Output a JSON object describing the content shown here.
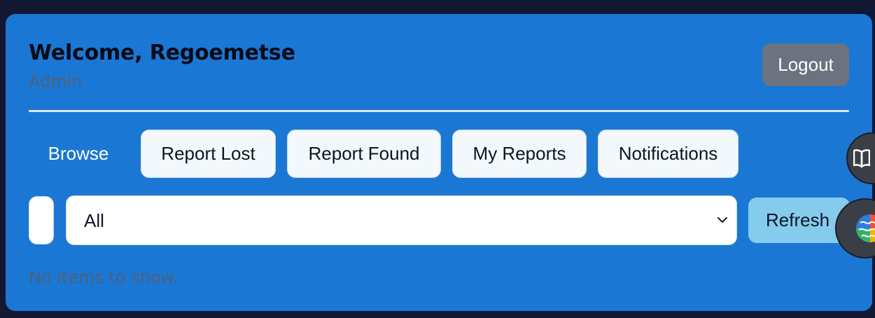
{
  "header": {
    "welcome": "Welcome, Regoemetse",
    "role": "Admin",
    "logout_label": "Logout"
  },
  "tabs": [
    {
      "label": "Browse",
      "active": true
    },
    {
      "label": "Report Lost",
      "active": false
    },
    {
      "label": "Report Found",
      "active": false
    },
    {
      "label": "My Reports",
      "active": false
    },
    {
      "label": "Notifications",
      "active": false
    }
  ],
  "filters": {
    "status_select_value": "All",
    "refresh_label": "Refresh"
  },
  "list": {
    "empty_message": "No items to show."
  },
  "floating_buttons": [
    {
      "icon": "book-icon"
    },
    {
      "icon": "brain-icon"
    }
  ],
  "colors": {
    "page_background": "#121834",
    "card_background": "#1b77d4",
    "logout_button": "#6b7280",
    "refresh_button": "#85cbec",
    "muted_text": "#4f6078"
  }
}
